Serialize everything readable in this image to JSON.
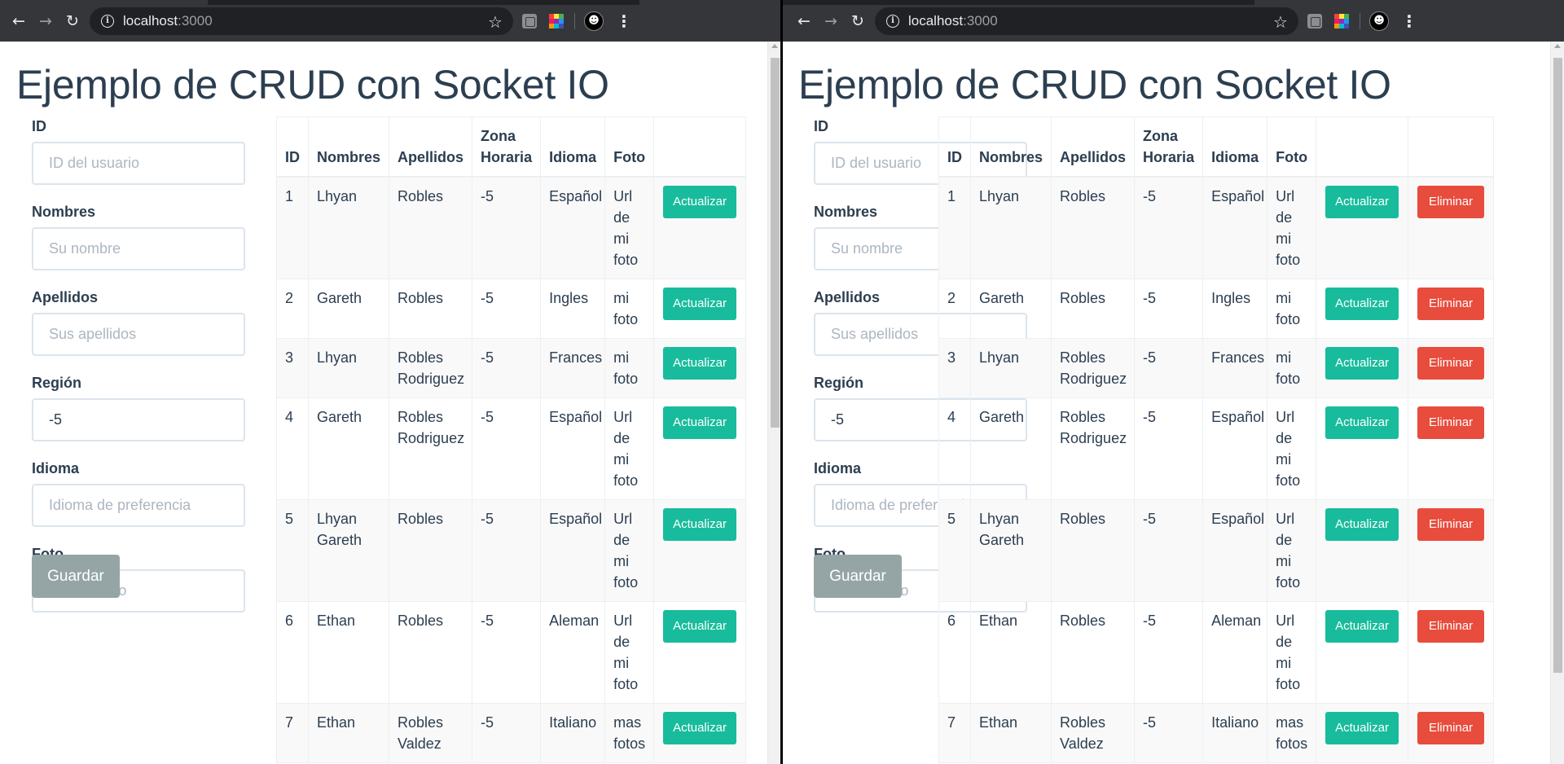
{
  "browser": {
    "host": "localhost",
    "port": ":3000"
  },
  "page": {
    "title": "Ejemplo de CRUD con Socket IO"
  },
  "form": {
    "id_label": "ID",
    "id_placeholder": "ID del usuario",
    "id_value": "",
    "nombres_label": "Nombres",
    "nombres_placeholder": "Su nombre",
    "nombres_value": "",
    "apellidos_label": "Apellidos",
    "apellidos_placeholder": "Sus apellidos",
    "apellidos_value": "",
    "region_label": "Región",
    "region_placeholder": "",
    "region_value": "-5",
    "idioma_label": "Idioma",
    "idioma_placeholder": "Idioma de preferencia",
    "idioma_value": "",
    "foto_label": "Foto",
    "foto_placeholder": "URL de foto",
    "foto_value": "",
    "save_label": "Guardar"
  },
  "table": {
    "headers": [
      "ID",
      "Nombres",
      "Apellidos",
      "Zona Horaria",
      "Idioma",
      "Foto"
    ],
    "update_label": "Actualizar",
    "delete_label": "Eliminar",
    "rows": [
      {
        "id": "1",
        "nombres": "Lhyan",
        "apellidos": "Robles",
        "zona": "-5",
        "idioma": "Español",
        "foto": "Url de mi foto"
      },
      {
        "id": "2",
        "nombres": "Gareth",
        "apellidos": "Robles",
        "zona": "-5",
        "idioma": "Ingles",
        "foto": "mi foto"
      },
      {
        "id": "3",
        "nombres": "Lhyan",
        "apellidos": "Robles Rodriguez",
        "zona": "-5",
        "idioma": "Frances",
        "foto": "mi foto"
      },
      {
        "id": "4",
        "nombres": "Gareth",
        "apellidos": "Robles Rodriguez",
        "zona": "-5",
        "idioma": "Español",
        "foto": "Url de mi foto"
      },
      {
        "id": "5",
        "nombres": "Lhyan Gareth",
        "apellidos": "Robles",
        "zona": "-5",
        "idioma": "Español",
        "foto": "Url de mi foto"
      },
      {
        "id": "6",
        "nombres": "Ethan",
        "apellidos": "Robles",
        "zona": "-5",
        "idioma": "Aleman",
        "foto": "Url de mi foto"
      },
      {
        "id": "7",
        "nombres": "Ethan",
        "apellidos": "Robles Valdez",
        "zona": "-5",
        "idioma": "Italiano",
        "foto": "mas fotos"
      }
    ]
  },
  "colors": {
    "primary_text": "#2c3e50",
    "success": "#18bc9c",
    "danger": "#e74c3c",
    "secondary": "#95a5a6",
    "chrome_toolbar": "#35363a"
  },
  "icons": [
    "back-arrow-icon",
    "forward-arrow-icon",
    "reload-icon",
    "info-icon",
    "star-icon",
    "extension-icon",
    "color-extension-icon",
    "profile-avatar-icon",
    "menu-dots-icon"
  ]
}
